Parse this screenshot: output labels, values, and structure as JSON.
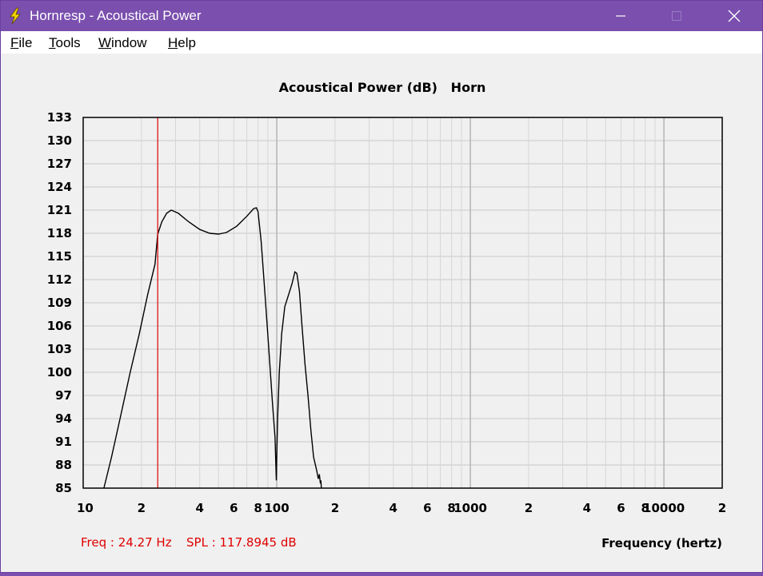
{
  "window": {
    "title": "Hornresp - Acoustical Power",
    "colors": {
      "titlebar": "#7a4fae",
      "client": "#f0f0f0",
      "cursor": "#e00000",
      "curve": "#000000",
      "grid": "#c8c8c8"
    }
  },
  "menu": [
    {
      "accel": "F",
      "rest": "ile"
    },
    {
      "accel": "T",
      "rest": "ools"
    },
    {
      "accel": "W",
      "rest": "indow"
    },
    {
      "accel": "H",
      "rest": "elp"
    }
  ],
  "chart_data": {
    "type": "line",
    "title": "Acoustical Power (dB)   Horn",
    "xlabel": "Frequency (hertz)",
    "ylabel": "",
    "x_scale": "log",
    "xlim": [
      10,
      20000
    ],
    "ylim": [
      85,
      133
    ],
    "y_ticks": [
      133,
      130,
      127,
      124,
      121,
      118,
      115,
      112,
      109,
      106,
      103,
      100,
      97,
      94,
      91,
      88,
      85
    ],
    "x_tick_labels": [
      {
        "v": 10,
        "t": "10"
      },
      {
        "v": 20,
        "t": "2"
      },
      {
        "v": 40,
        "t": "4"
      },
      {
        "v": 60,
        "t": "6"
      },
      {
        "v": 80,
        "t": "8"
      },
      {
        "v": 100,
        "t": "100"
      },
      {
        "v": 200,
        "t": "2"
      },
      {
        "v": 400,
        "t": "4"
      },
      {
        "v": 600,
        "t": "6"
      },
      {
        "v": 800,
        "t": "8"
      },
      {
        "v": 1000,
        "t": "1000"
      },
      {
        "v": 2000,
        "t": "2"
      },
      {
        "v": 4000,
        "t": "4"
      },
      {
        "v": 6000,
        "t": "6"
      },
      {
        "v": 8000,
        "t": "8"
      },
      {
        "v": 10000,
        "t": "10000"
      },
      {
        "v": 20000,
        "t": "2"
      }
    ],
    "grid": true,
    "cursor": {
      "freq": 24.27,
      "spl": 117.8945
    },
    "readout": {
      "freq_text": "Freq : 24.27 Hz",
      "spl_text": "SPL : 117.8945 dB"
    },
    "series": [
      {
        "values": [
          [
            12.8,
            85
          ],
          [
            14.0,
            89
          ],
          [
            15.5,
            94
          ],
          [
            17.5,
            100
          ],
          [
            19.5,
            105
          ],
          [
            21.5,
            110
          ],
          [
            23.5,
            114
          ],
          [
            24.27,
            117.9
          ],
          [
            25.5,
            119.5
          ],
          [
            27.0,
            120.6
          ],
          [
            28.5,
            121.0
          ],
          [
            31.0,
            120.6
          ],
          [
            35.0,
            119.5
          ],
          [
            40.0,
            118.5
          ],
          [
            45.0,
            118.0
          ],
          [
            50.0,
            117.9
          ],
          [
            55.0,
            118.1
          ],
          [
            62.0,
            118.9
          ],
          [
            70.0,
            120.2
          ],
          [
            76.0,
            121.2
          ],
          [
            78.5,
            121.3
          ],
          [
            80.0,
            120.8
          ],
          [
            83.0,
            117.0
          ],
          [
            87.0,
            110.0
          ],
          [
            91.0,
            103.0
          ],
          [
            95.0,
            96.0
          ],
          [
            98.0,
            91.5
          ],
          [
            99.5,
            86.0
          ],
          [
            100.0,
            89.0
          ],
          [
            101.0,
            94.0
          ],
          [
            103.0,
            100.0
          ],
          [
            106.0,
            105.0
          ],
          [
            110.0,
            108.5
          ],
          [
            115.0,
            110.0
          ],
          [
            120.0,
            111.5
          ],
          [
            124.0,
            113.0
          ],
          [
            127.0,
            112.8
          ],
          [
            131.0,
            110.5
          ],
          [
            135.0,
            106.0
          ],
          [
            140.0,
            101.0
          ],
          [
            145.0,
            97.0
          ],
          [
            150.0,
            92.5
          ],
          [
            155.0,
            89.0
          ],
          [
            160.0,
            87.5
          ],
          [
            164.0,
            86.2
          ],
          [
            166.0,
            86.8
          ],
          [
            168.0,
            85.6
          ],
          [
            169.0,
            86.0
          ],
          [
            170.0,
            85.0
          ]
        ]
      }
    ]
  }
}
